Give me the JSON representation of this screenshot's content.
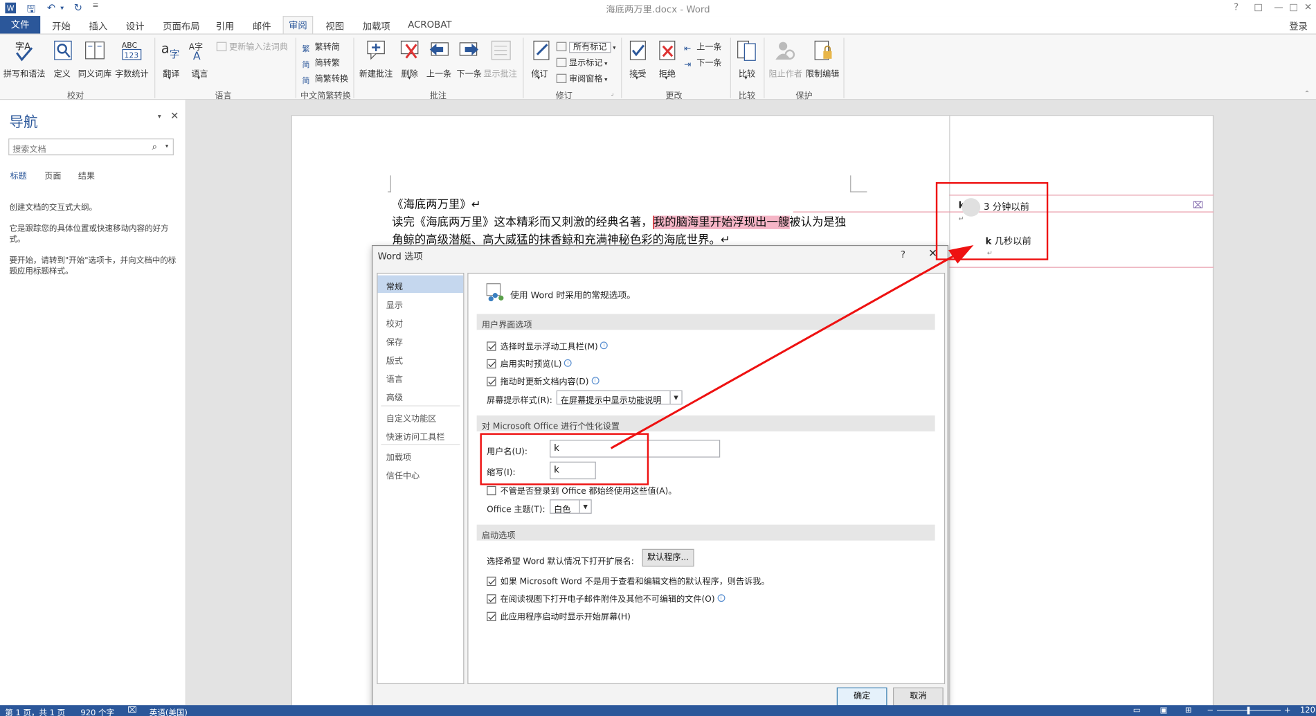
{
  "window": {
    "title": "海底两万里.docx - Word",
    "help": "?",
    "restore": "□",
    "minimize": "—",
    "maximize": "□",
    "close": "✕",
    "signin": "登录"
  },
  "tabs": {
    "file": "文件",
    "items": [
      "开始",
      "插入",
      "设计",
      "页面布局",
      "引用",
      "邮件"
    ],
    "active": "审阅",
    "after": [
      "视图",
      "加载项",
      "ACROBAT"
    ]
  },
  "ribbon": {
    "proofing": {
      "spell": "拼写和语法",
      "define": "定义",
      "thesaurus": "同义词库",
      "wordcount": "字数统计",
      "group": "校对"
    },
    "language": {
      "translate": "翻译",
      "lang": "语言",
      "ime": "更新输入法词典",
      "group": "语言"
    },
    "chinese": {
      "t2s": "繁转简",
      "s2t": "简转繁",
      "conv": "简繁转换",
      "group": "中文简繁转换"
    },
    "comments": {
      "new": "新建批注",
      "delete": "删除",
      "prev": "上一条",
      "next": "下一条",
      "show": "显示批注",
      "group": "批注"
    },
    "tracking": {
      "track": "修订",
      "markup": "所有标记",
      "showmarkup": "显示标记",
      "pane": "审阅窗格",
      "group": "修订"
    },
    "changes": {
      "accept": "接受",
      "reject": "拒绝",
      "prev": "上一条",
      "next": "下一条",
      "group": "更改"
    },
    "compare": {
      "compare": "比较",
      "group": "比较"
    },
    "protect": {
      "block": "阻止作者",
      "restrict": "限制编辑",
      "group": "保护"
    }
  },
  "nav": {
    "title": "导航",
    "search_placeholder": "搜索文档",
    "tabs": [
      "标题",
      "页面",
      "结果"
    ],
    "text1": "创建文档的交互式大纲。",
    "text2": "它是跟踪您的具体位置或快速移动内容的好方式。",
    "text3": "要开始，请转到\"开始\"选项卡，并向文档中的标题应用标题样式。"
  },
  "doc": {
    "line1": "《海底两万里》↵",
    "line2a": "读完《海底两万里》这本精彩而又刺激的经典名著，",
    "line2b": "我的脑海里开始浮现出一艘",
    "line2c": "被认为是独",
    "line3": "角鲸的高级潜艇、高大威猛的抹香鲸和充满神秘色彩的海底世界。↵"
  },
  "comments": {
    "c1_author": "k",
    "c1_time": "3 分钟以前",
    "c2_author": "k",
    "c2_time": "几秒以前",
    "mark": "↵"
  },
  "dialog": {
    "title": "Word 选项",
    "help": "?",
    "close": "✕",
    "nav": [
      "常规",
      "显示",
      "校对",
      "保存",
      "版式",
      "语言",
      "高级",
      "自定义功能区",
      "快速访问工具栏",
      "加载项",
      "信任中心"
    ],
    "header": "使用 Word 时采用的常规选项。",
    "ui_section": "用户界面选项",
    "opt1": "选择时显示浮动工具栏(M)",
    "opt2": "启用实时预览(L)",
    "opt3": "拖动时更新文档内容(D)",
    "tip_label": "屏幕提示样式(R):",
    "tip_value": "在屏幕提示中显示功能说明",
    "personal_section": "对 Microsoft Office 进行个性化设置",
    "user_label": "用户名(U):",
    "user_value": "k",
    "initials_label": "缩写(I):",
    "initials_value": "k",
    "always": "不管是否登录到 Office 都始终使用这些值(A)。",
    "theme_label": "Office 主题(T):",
    "theme_value": "白色",
    "startup_section": "启动选项",
    "ext_label": "选择希望 Word 默认情况下打开扩展名:",
    "ext_button": "默认程序...",
    "opt4": "如果 Microsoft Word 不是用于查看和编辑文档的默认程序，则告诉我。",
    "opt5": "在阅读视图下打开电子邮件附件及其他不可编辑的文件(O)",
    "opt6": "此应用程序启动时显示开始屏幕(H)",
    "ok": "确定",
    "cancel": "取消"
  },
  "status": {
    "page": "第 1 页，共 1 页",
    "words": "920 个字",
    "lang": "英语(美国)",
    "zoom": "120"
  },
  "colors": {
    "accent": "#2b579a",
    "highlight": "#f5b5c6",
    "annotation": "#ee1111"
  }
}
